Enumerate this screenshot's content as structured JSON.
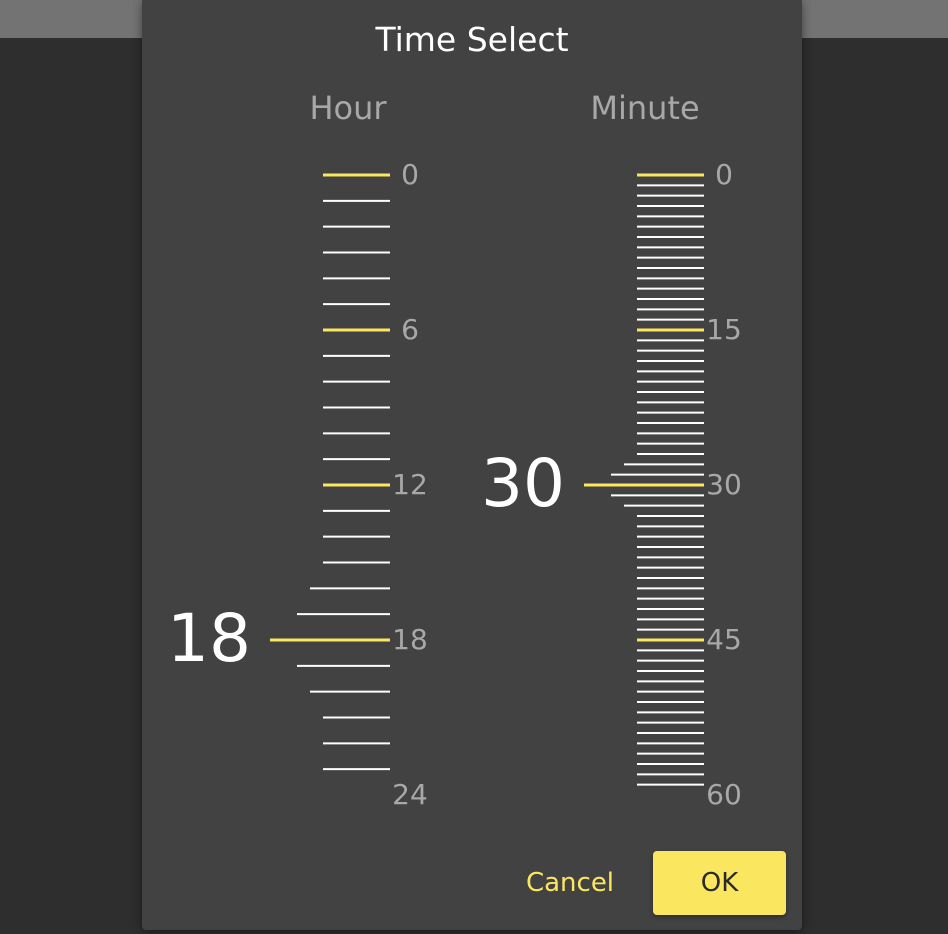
{
  "dialog": {
    "title": "Time Select",
    "cancel_label": "Cancel",
    "ok_label": "OK"
  },
  "hour": {
    "label": "Hour",
    "selected": 18,
    "min": 0,
    "max": 24,
    "major_step": 6,
    "tick_labels": [
      "0",
      "6",
      "12",
      "18",
      "24"
    ]
  },
  "minute": {
    "label": "Minute",
    "selected": 30,
    "min": 0,
    "max": 60,
    "major_step": 15,
    "tick_labels": [
      "0",
      "15",
      "30",
      "45",
      "60"
    ]
  },
  "colors": {
    "accent": "#fbe75f",
    "tick": "#ffffff",
    "dialog_bg": "#424242",
    "muted_text": "#a8a8a8"
  }
}
